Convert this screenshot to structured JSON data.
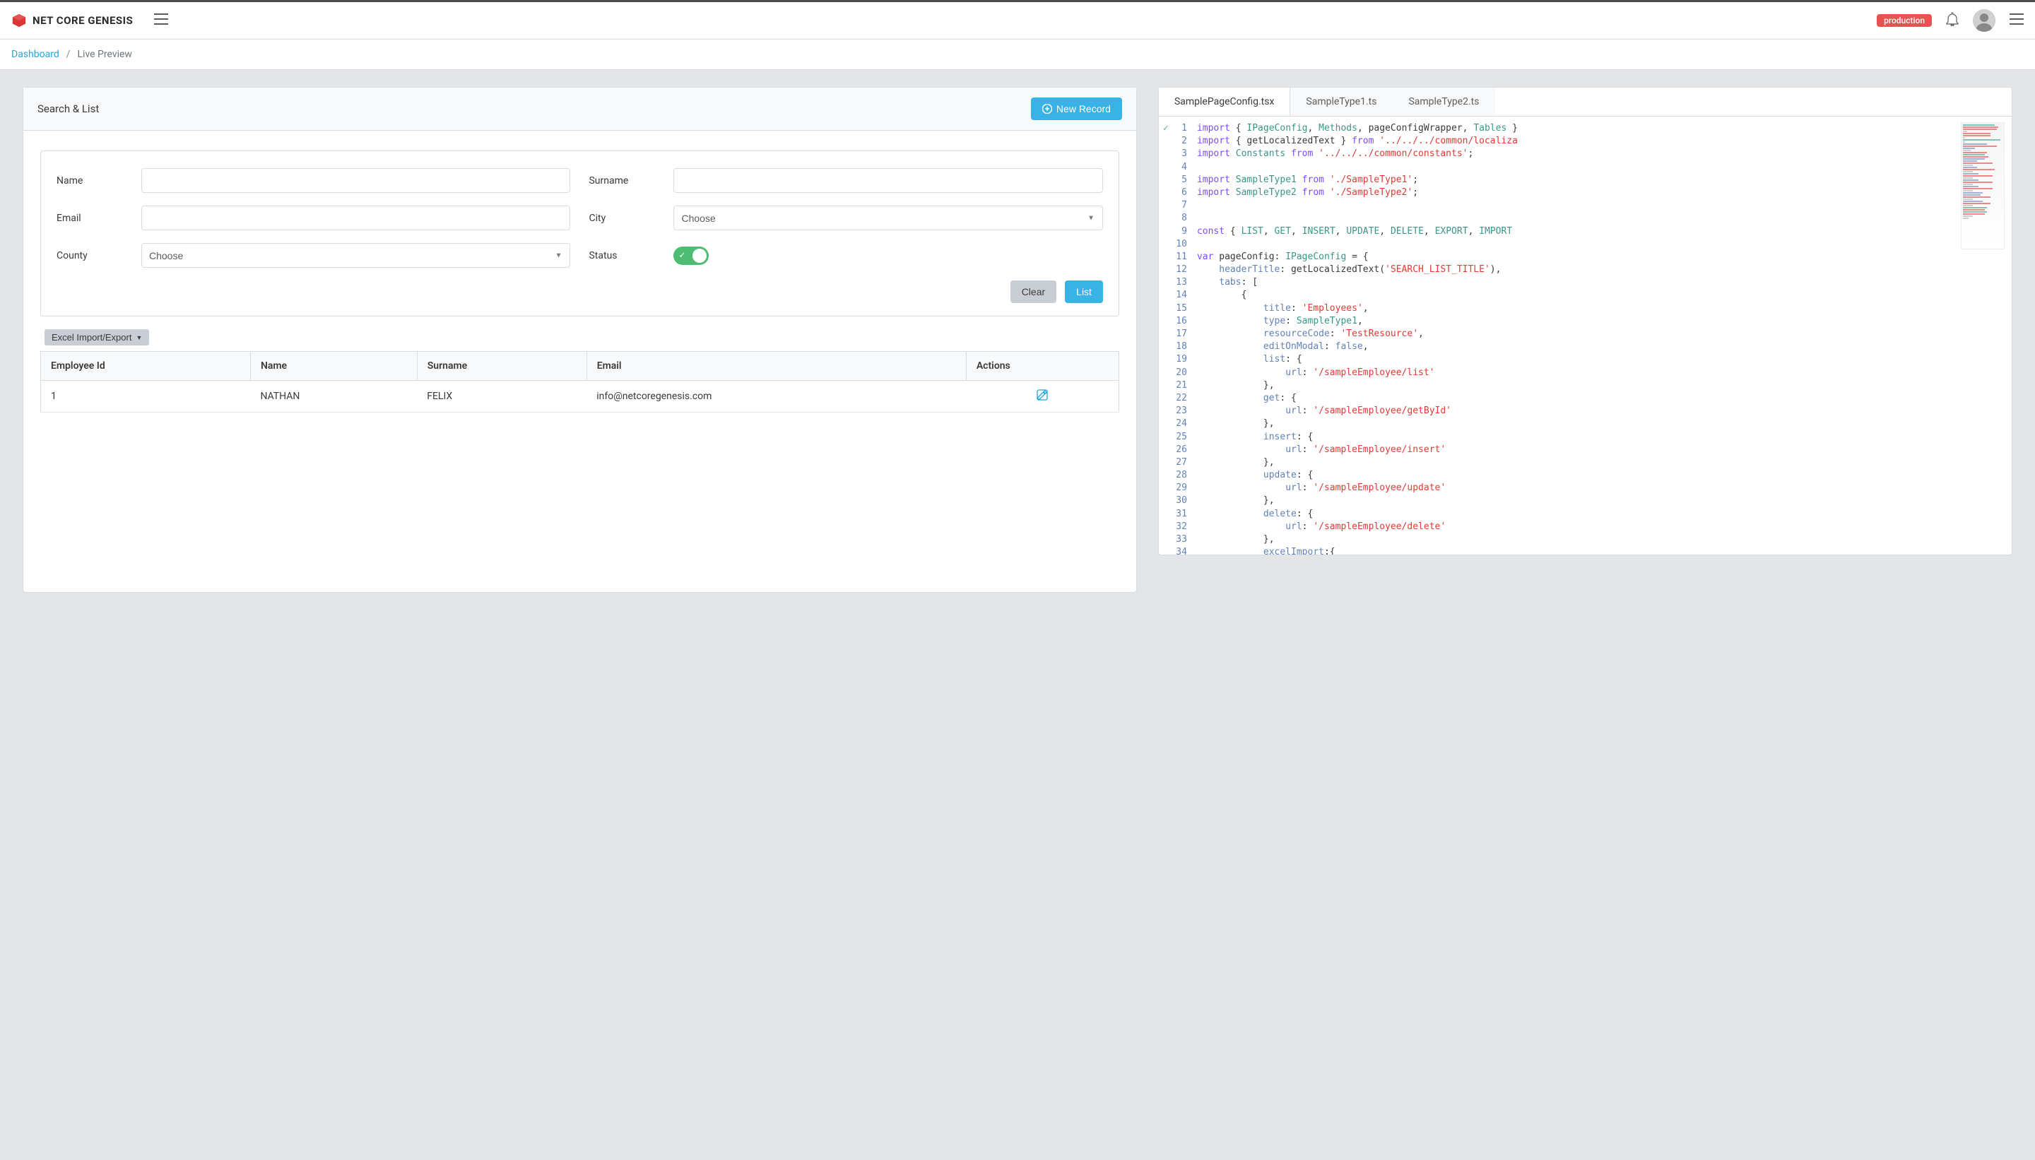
{
  "header": {
    "brand": "NET CORE GENESIS",
    "env_badge": "production"
  },
  "breadcrumb": {
    "root": "Dashboard",
    "current": "Live Preview"
  },
  "search_panel": {
    "title": "Search & List",
    "new_record": "New Record",
    "labels": {
      "name": "Name",
      "surname": "Surname",
      "email": "Email",
      "city": "City",
      "county": "County",
      "status": "Status"
    },
    "choose_placeholder": "Choose",
    "clear": "Clear",
    "list": "List",
    "excel": "Excel Import/Export"
  },
  "table": {
    "headers": {
      "id": "Employee Id",
      "name": "Name",
      "surname": "Surname",
      "email": "Email",
      "actions": "Actions"
    },
    "rows": [
      {
        "id": "1",
        "name": "NATHAN",
        "surname": "FELIX",
        "email": "info@netcoregenesis.com"
      }
    ]
  },
  "code": {
    "tabs": [
      "SamplePageConfig.tsx",
      "SampleType1.ts",
      "SampleType2.ts"
    ],
    "active_tab": 0,
    "lines": [
      {
        "n": 1,
        "html": "<span class='tok-kw'>import</span> { <span class='tok-type'>IPageConfig</span>, <span class='tok-type'>Methods</span>, pageConfigWrapper, <span class='tok-type'>Tables</span> }"
      },
      {
        "n": 2,
        "html": "<span class='tok-kw'>import</span> { getLocalizedText } <span class='tok-kw'>from</span> <span class='tok-str'>'../../../common/localiza</span>"
      },
      {
        "n": 3,
        "html": "<span class='tok-kw'>import</span> <span class='tok-type'>Constants</span> <span class='tok-kw'>from</span> <span class='tok-str'>'../../../common/constants'</span>;"
      },
      {
        "n": 4,
        "html": ""
      },
      {
        "n": 5,
        "html": "<span class='tok-kw'>import</span> <span class='tok-type'>SampleType1</span> <span class='tok-kw'>from</span> <span class='tok-str'>'./SampleType1'</span>;"
      },
      {
        "n": 6,
        "html": "<span class='tok-kw'>import</span> <span class='tok-type'>SampleType2</span> <span class='tok-kw'>from</span> <span class='tok-str'>'./SampleType2'</span>;"
      },
      {
        "n": 7,
        "html": ""
      },
      {
        "n": 8,
        "html": ""
      },
      {
        "n": 9,
        "html": "<span class='tok-kw'>const</span> { <span class='tok-type'>LIST</span>, <span class='tok-type'>GET</span>, <span class='tok-type'>INSERT</span>, <span class='tok-type'>UPDATE</span>, <span class='tok-type'>DELETE</span>, <span class='tok-type'>EXPORT</span>, <span class='tok-type'>IMPORT</span>"
      },
      {
        "n": 10,
        "html": ""
      },
      {
        "n": 11,
        "html": "<span class='tok-kw'>var</span> pageConfig: <span class='tok-type'>IPageConfig</span> = {"
      },
      {
        "n": 12,
        "html": "    <span class='tok-blue'>headerTitle</span>: getLocalizedText(<span class='tok-str'>'SEARCH_LIST_TITLE'</span>),"
      },
      {
        "n": 13,
        "html": "    <span class='tok-blue'>tabs</span>: ["
      },
      {
        "n": 14,
        "html": "        {"
      },
      {
        "n": 15,
        "html": "            <span class='tok-blue'>title</span>: <span class='tok-str'>'Employees'</span>,"
      },
      {
        "n": 16,
        "html": "            <span class='tok-blue'>type</span>: <span class='tok-type'>SampleType1</span>,"
      },
      {
        "n": 17,
        "html": "            <span class='tok-blue'>resourceCode</span>: <span class='tok-str'>'TestResource'</span>,"
      },
      {
        "n": 18,
        "html": "            <span class='tok-blue'>editOnModal</span>: <span class='tok-bool'>false</span>,"
      },
      {
        "n": 19,
        "html": "            <span class='tok-blue'>list</span>: {"
      },
      {
        "n": 20,
        "html": "                <span class='tok-blue'>url</span>: <span class='tok-str'>'/sampleEmployee/list'</span>"
      },
      {
        "n": 21,
        "html": "            },"
      },
      {
        "n": 22,
        "html": "            <span class='tok-blue'>get</span>: {"
      },
      {
        "n": 23,
        "html": "                <span class='tok-blue'>url</span>: <span class='tok-str'>'/sampleEmployee/getById'</span>"
      },
      {
        "n": 24,
        "html": "            },"
      },
      {
        "n": 25,
        "html": "            <span class='tok-blue'>insert</span>: {"
      },
      {
        "n": 26,
        "html": "                <span class='tok-blue'>url</span>: <span class='tok-str'>'/sampleEmployee/insert'</span>"
      },
      {
        "n": 27,
        "html": "            },"
      },
      {
        "n": 28,
        "html": "            <span class='tok-blue'>update</span>: {"
      },
      {
        "n": 29,
        "html": "                <span class='tok-blue'>url</span>: <span class='tok-str'>'/sampleEmployee/update'</span>"
      },
      {
        "n": 30,
        "html": "            },"
      },
      {
        "n": 31,
        "html": "            <span class='tok-blue'>delete</span>: {"
      },
      {
        "n": 32,
        "html": "                <span class='tok-blue'>url</span>: <span class='tok-str'>'/sampleEmployee/delete'</span>"
      },
      {
        "n": 33,
        "html": "            },"
      },
      {
        "n": 34,
        "html": "            <span class='tok-blue'>excelImport</span>:{"
      }
    ]
  }
}
